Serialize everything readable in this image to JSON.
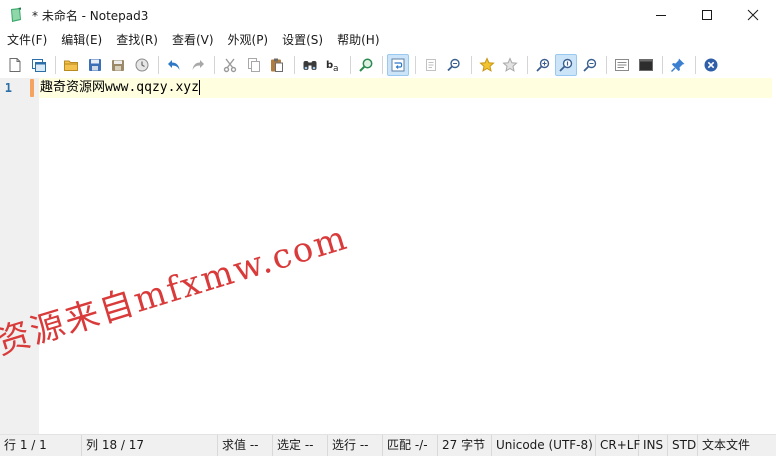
{
  "window": {
    "title": "* 未命名 - Notepad3",
    "controls": [
      "minimize-icon",
      "maximize-icon",
      "close-icon"
    ]
  },
  "menu": {
    "items": [
      {
        "label": "文件(F)"
      },
      {
        "label": "编辑(E)"
      },
      {
        "label": "查找(R)"
      },
      {
        "label": "查看(V)"
      },
      {
        "label": "外观(P)"
      },
      {
        "label": "设置(S)"
      },
      {
        "label": "帮助(H)"
      }
    ]
  },
  "toolbar": {
    "buttons": [
      "new-file-icon",
      "open-window-icon",
      "open-folder-icon",
      "save-icon",
      "save-as-icon",
      "history-icon",
      "undo-icon",
      "redo-icon",
      "cut-icon",
      "copy-icon",
      "paste-icon",
      "find-icon",
      "replace-icon",
      "goto-icon",
      "word-wrap-icon",
      "copy-all-icon",
      "zoom-find-icon",
      "favorite-icon",
      "add-favorite-icon",
      "zoom-in-icon",
      "zoom-reset-icon",
      "zoom-out-icon",
      "scheme-icon",
      "console-icon",
      "pin-icon",
      "close-doc-icon"
    ],
    "active": [
      "word-wrap-icon",
      "zoom-reset-icon"
    ]
  },
  "editor": {
    "line_number": "1",
    "content": "趣奇资源网www.qqzy.xyz"
  },
  "watermark": {
    "text": "资源来自mfxmw.com"
  },
  "status": {
    "line": "行  1 / 1",
    "column": "列  18 / 17",
    "value": "求值  --",
    "selection": "选定  --",
    "selected_lines": "选行  --",
    "match": "匹配  -/-",
    "size": "27 字节",
    "encoding": "Unicode (UTF-8)",
    "eol": "CR+LF",
    "ins": "INS",
    "std": "STD",
    "mode": "文本文件"
  },
  "colors": {
    "current_line": "#ffffe0",
    "gutter": "#f0f0f0",
    "line_number": "#2b6ea8",
    "watermark": "#d93a3a",
    "change_marker": "#f4a460"
  }
}
